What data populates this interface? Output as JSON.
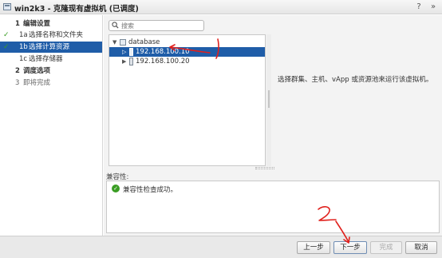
{
  "window": {
    "title": "win2k3 - 克隆现有虚拟机 (已调度)",
    "help_glyph": "?",
    "close_glyph": "»"
  },
  "nav": {
    "steps": [
      {
        "num": "1",
        "label": "编辑设置",
        "type": "step",
        "done": false,
        "active": false
      },
      {
        "num": "1a",
        "label": "选择名称和文件夹",
        "type": "sub",
        "done": true,
        "active": false
      },
      {
        "num": "1b",
        "label": "选择计算资源",
        "type": "sub",
        "done": true,
        "active": true
      },
      {
        "num": "1c",
        "label": "选择存储器",
        "type": "sub",
        "done": false,
        "active": false
      },
      {
        "num": "2",
        "label": "调度选项",
        "type": "step",
        "done": false,
        "active": false
      },
      {
        "num": "3",
        "label": "即将完成",
        "type": "step",
        "done": false,
        "active": false,
        "inactive": true
      }
    ],
    "check_glyph": "✓"
  },
  "search": {
    "placeholder": "搜索"
  },
  "tree": {
    "root": "database",
    "hosts": [
      "192.168.100.10",
      "192.168.100.20"
    ],
    "selected_index": 0
  },
  "info": {
    "text": "选择群集、主机、vApp 或资源池来运行该虚拟机。"
  },
  "compatibility": {
    "label": "兼容性:",
    "message": "兼容性检查成功。",
    "ok_glyph": "✓"
  },
  "buttons": {
    "back": "上一步",
    "next": "下一步",
    "finish": "完成",
    "cancel": "取消"
  },
  "annotations": {
    "mark_1": "1",
    "mark_2": "2",
    "color": "#e0201c"
  },
  "colors": {
    "selection": "#1f5da8",
    "success": "#3a9d23"
  }
}
